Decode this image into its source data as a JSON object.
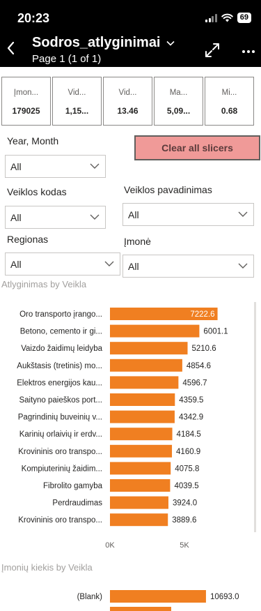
{
  "status_bar": {
    "time": "20:23",
    "battery": "69"
  },
  "header": {
    "title": "Sodros_atlyginimai",
    "subtitle": "Page 1 (1 of 1)",
    "back_icon": "chevron-left-icon",
    "expand_icon": "expand-icon",
    "more_icon": "more-icon"
  },
  "cards": [
    {
      "label": "Įmon...",
      "value": "179025"
    },
    {
      "label": "Vid...",
      "value": "1,15..."
    },
    {
      "label": "Vid...",
      "value": "13.46"
    },
    {
      "label": "Ma...",
      "value": "5,09..."
    },
    {
      "label": "Mi...",
      "value": "0.68"
    }
  ],
  "slicers": {
    "year_month": {
      "label": "Year, Month",
      "value": "All"
    },
    "clear_button": "Clear all slicers",
    "veiklos_kodas": {
      "label": "Veiklos kodas",
      "value": "All"
    },
    "veiklos_pavadinimas": {
      "label": "Veiklos pavadinimas",
      "value": "All"
    },
    "regionas": {
      "label": "Regionas",
      "value": "All"
    },
    "imone": {
      "label": "Įmonė",
      "value": "All"
    }
  },
  "colors": {
    "bar": "#f07f21",
    "header_bg": "#000000",
    "clear_button_bg": "#f09a98"
  },
  "chart_data": [
    {
      "type": "bar",
      "orientation": "horizontal",
      "title": "Atlyginimas by Veikla",
      "categories": [
        "Oro transporto įrango...",
        "Betono, cemento ir gi...",
        "Vaizdo žaidimų leidyba",
        "Aukštasis (tretinis) mo...",
        "Elektros energijos kau...",
        "Saityno paieškos port...",
        "Pagrindinių buveinių v...",
        "Karinių orlaivių ir erdv...",
        "Krovininis oro transpo...",
        "Kompiuterinių žaidim...",
        "Fibrolito gamyba",
        "Perdraudimas",
        "Krovininis oro transpo..."
      ],
      "values": [
        7222.6,
        6001.1,
        5210.6,
        4854.6,
        4596.7,
        4359.5,
        4342.9,
        4184.5,
        4160.9,
        4075.8,
        4039.5,
        3924.0,
        3889.6
      ],
      "value_labels": [
        "7222.6",
        "6001.1",
        "5210.6",
        "4854.6",
        "4596.7",
        "4359.5",
        "4342.9",
        "4184.5",
        "4160.9",
        "4075.8",
        "4039.5",
        "3924.0",
        "3889.6"
      ],
      "x_ticks": [
        "0K",
        "5K"
      ],
      "xlim": [
        0,
        7500
      ]
    },
    {
      "type": "bar",
      "orientation": "horizontal",
      "title": "Įmonių kiekis by Veikla",
      "categories": [
        "(Blank)"
      ],
      "values": [
        10693.0
      ],
      "value_labels": [
        "10693.0"
      ],
      "xlim": [
        0,
        15000
      ]
    }
  ]
}
